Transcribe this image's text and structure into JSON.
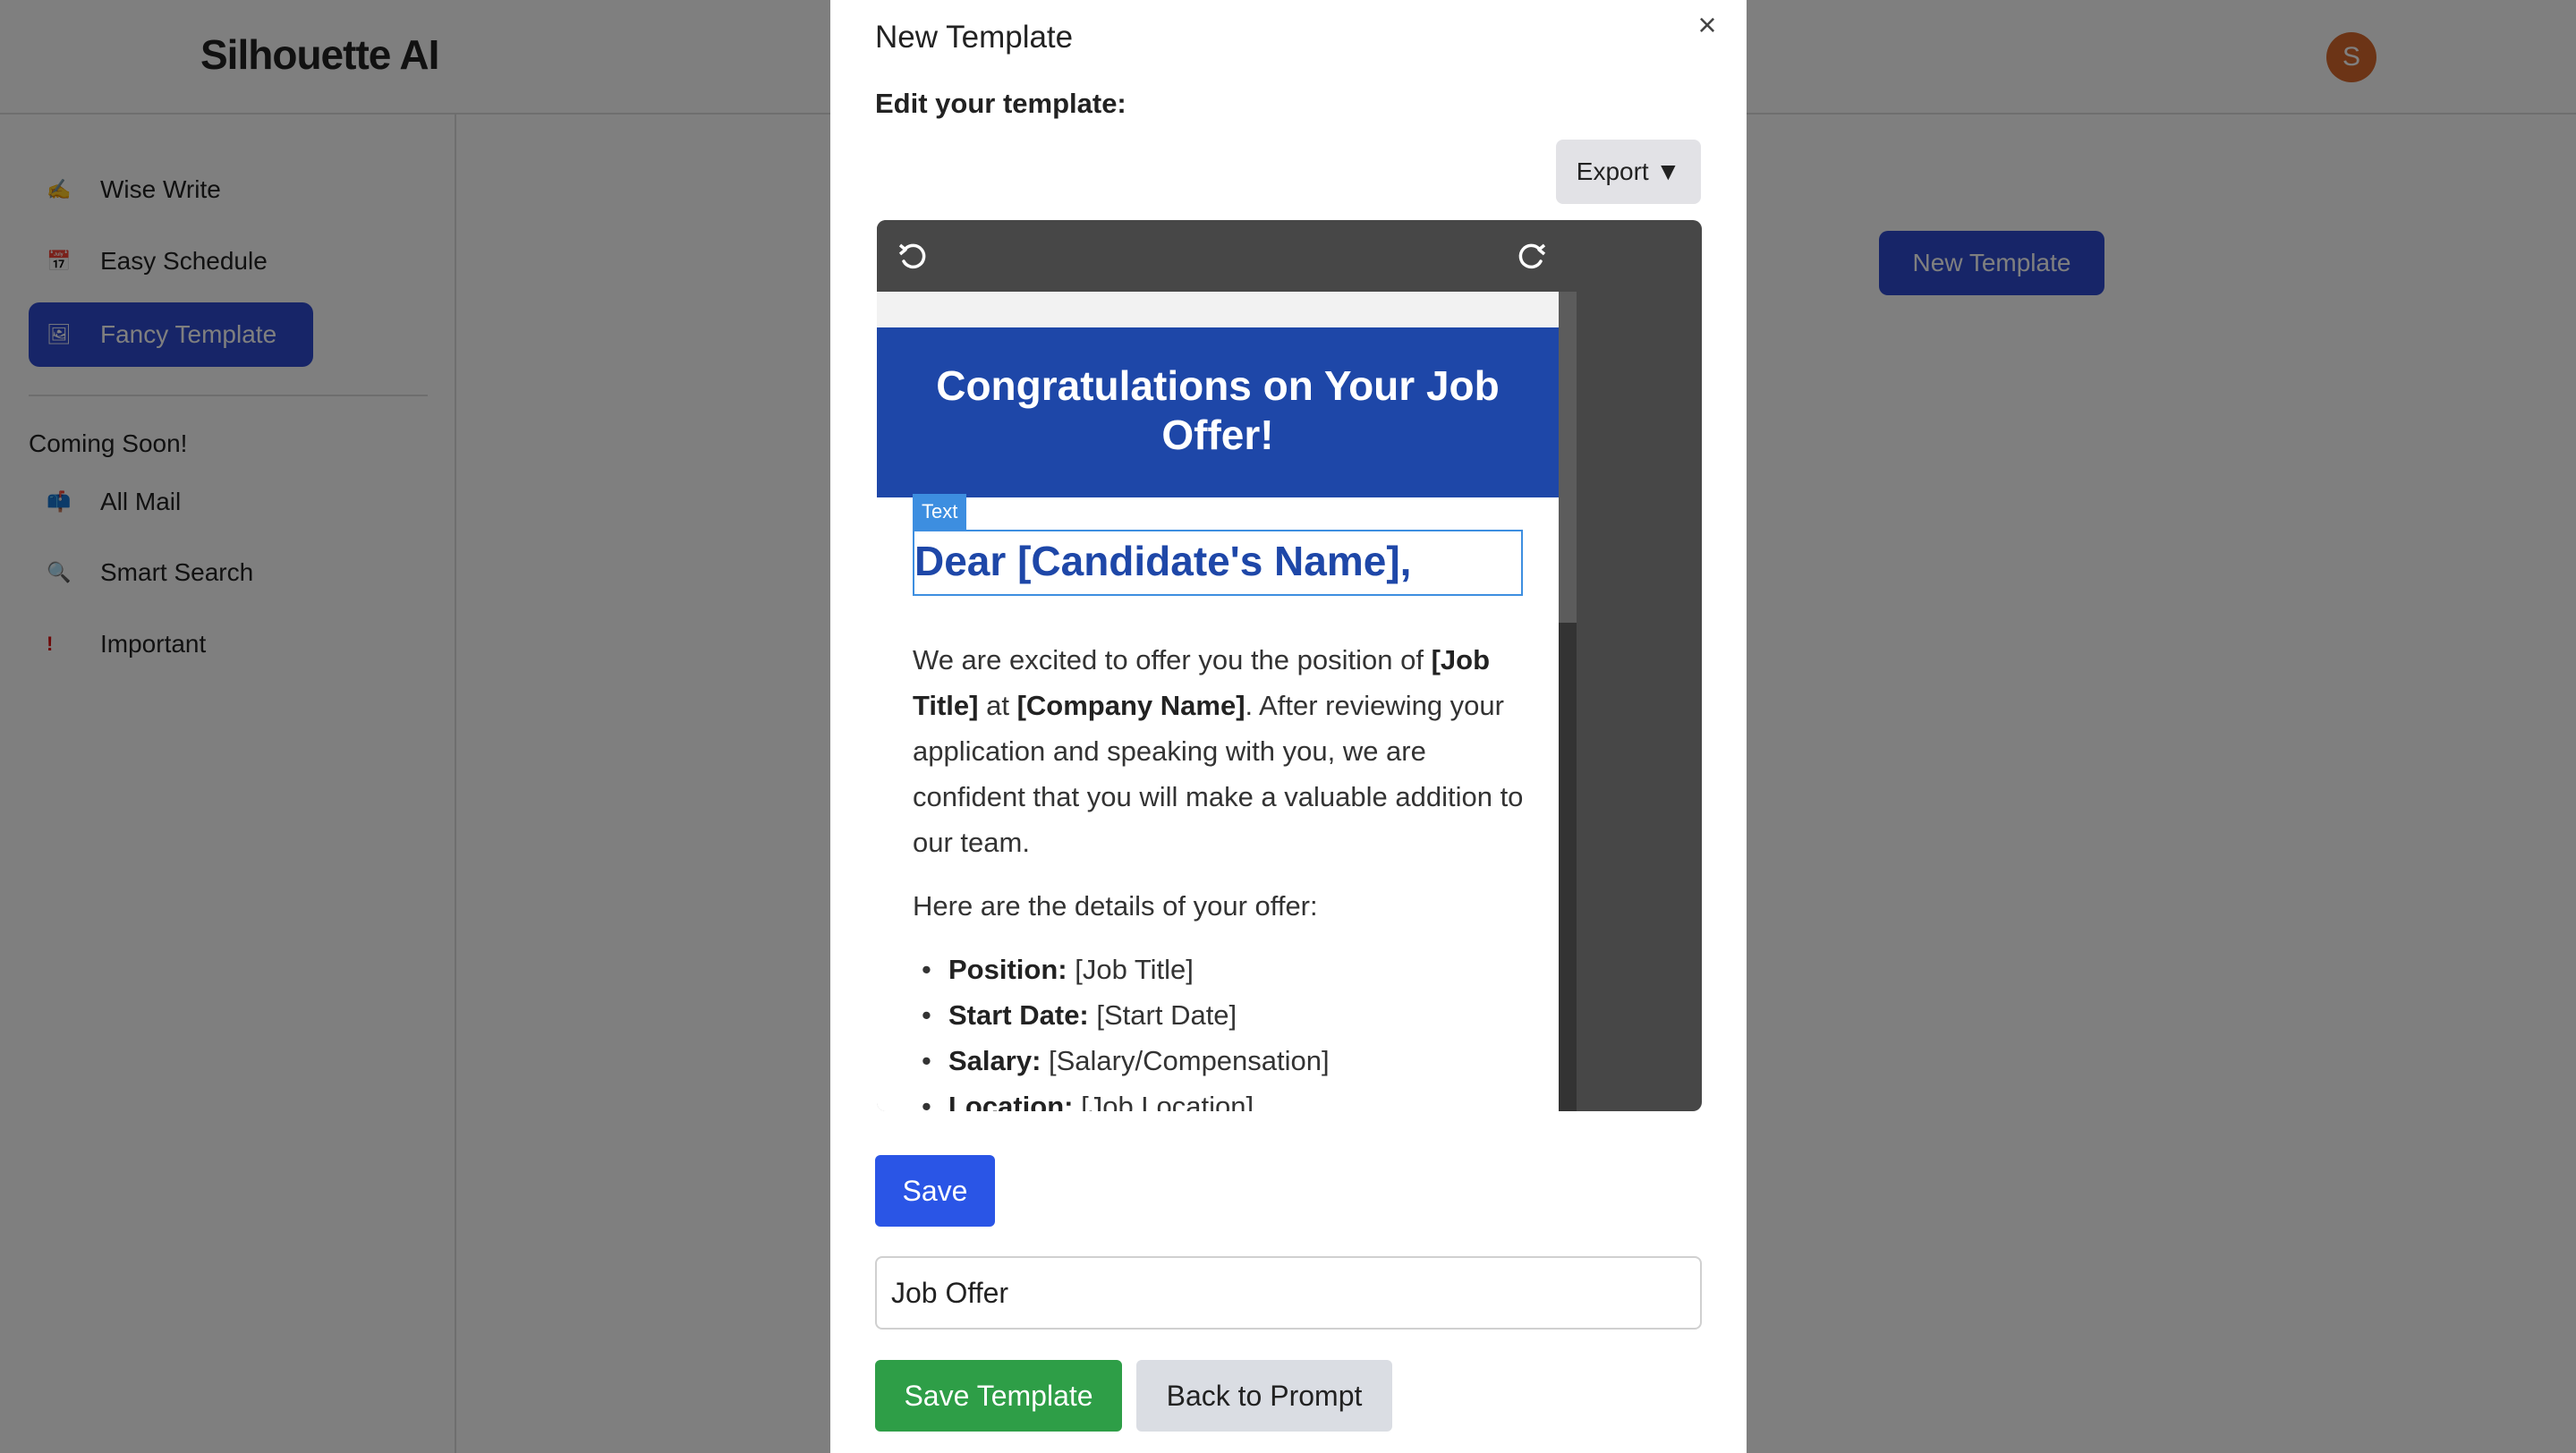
{
  "app": {
    "brand": "Silhouette AI",
    "avatar_initial": "S",
    "new_template_label": "New Template"
  },
  "sidebar": {
    "items": [
      {
        "icon": "pen-writing-icon",
        "glyph": "✍",
        "label": "Wise Write"
      },
      {
        "icon": "calendar-icon",
        "glyph": "📅",
        "label": "Easy Schedule"
      },
      {
        "icon": "framed-picture-icon",
        "glyph": "🖼",
        "label": "Fancy Template"
      }
    ],
    "coming_soon_label": "Coming Soon!",
    "coming_items": [
      {
        "icon": "mailbox-icon",
        "glyph": "📫",
        "label": "All Mail"
      },
      {
        "icon": "magnifier-icon",
        "glyph": "🔍",
        "label": "Smart Search"
      },
      {
        "icon": "exclamation-icon",
        "glyph": "!",
        "label": "Important"
      }
    ]
  },
  "modal": {
    "title": "New Template",
    "close_glyph": "×",
    "edit_label": "Edit your template:",
    "export_label": "Export ▼",
    "text_tag": "Text",
    "email": {
      "header": "Congratulations on Your Job Offer!",
      "greeting": "Dear [Candidate's Name],",
      "intro": {
        "t1": "We are excited to offer you the position of ",
        "b1": "[Job Title]",
        "t2": " at ",
        "b2": "[Company Name]",
        "t3": ". After reviewing your application and speaking with you, we are confident that you will make a valuable addition to our team."
      },
      "details_intro": "Here are the details of your offer:",
      "details": [
        {
          "label": "Position:",
          "value": " [Job Title]"
        },
        {
          "label": "Start Date:",
          "value": " [Start Date]"
        },
        {
          "label": "Salary:",
          "value": " [Salary/Compensation]"
        },
        {
          "label": "Location:",
          "value": " [Job Location]"
        }
      ]
    },
    "save_label": "Save",
    "template_name_value": "Job Offer",
    "save_template_label": "Save Template",
    "back_label": "Back to Prompt"
  }
}
